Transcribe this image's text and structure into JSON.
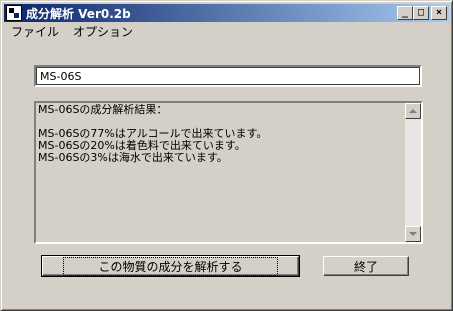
{
  "window": {
    "title": "成分解析  Ver0.2b",
    "icon": "app-icon",
    "minimize_glyph": "_",
    "maximize_glyph": "□",
    "close_glyph": "×"
  },
  "menu": {
    "items": [
      {
        "label": "ファイル"
      },
      {
        "label": "オプション"
      }
    ]
  },
  "input": {
    "value": "MS-06S"
  },
  "result": {
    "text": "MS-06Sの成分解析結果：\n\nMS-06Sの77%はアルコールで出来ています。\nMS-06Sの20%は着色料で出来ています。\nMS-06Sの3%は海水で出来ています。"
  },
  "buttons": {
    "analyze": "この物質の成分を解析する",
    "exit": "終了"
  },
  "colors": {
    "titlebar_start": "#0a246a",
    "titlebar_end": "#a6caf0",
    "face": "#d4d0c8"
  }
}
